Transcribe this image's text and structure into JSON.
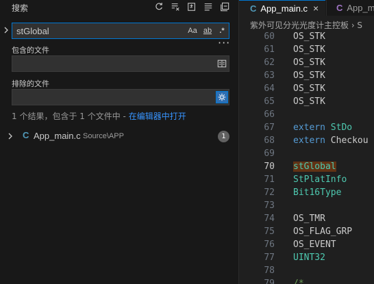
{
  "search_panel": {
    "title": "搜索",
    "toolbar": [
      {
        "name": "refresh-icon"
      },
      {
        "name": "clear-results-icon"
      },
      {
        "name": "new-search-editor-icon"
      },
      {
        "name": "view-as-tree-icon"
      },
      {
        "name": "collapse-all-icon"
      }
    ],
    "search": {
      "value": "stGlobal",
      "options": [
        "Aa",
        "ab",
        ".*"
      ]
    },
    "include": {
      "label": "包含的文件",
      "value": ""
    },
    "exclude": {
      "label": "排除的文件",
      "value": ""
    },
    "result_summary": "1 个结果，包含于 1 个文件中 - ",
    "open_in_editor": "在编辑器中打开",
    "file_result": {
      "icon": "C",
      "name": "App_main.c",
      "path": "Source\\APP",
      "count": "1"
    }
  },
  "editor": {
    "tabs": [
      {
        "icon": "C",
        "label": "App_main.c",
        "close": "×",
        "active": true
      },
      {
        "icon": "C",
        "label": "App_m"
      }
    ],
    "breadcrumb": "紫外可见分光光度计主控板 › S",
    "current_line": 70,
    "lines": [
      {
        "n": "60",
        "t": "OS_STK"
      },
      {
        "n": "61",
        "t": "OS_STK"
      },
      {
        "n": "62",
        "t": "OS_STK"
      },
      {
        "n": "63",
        "t": "OS_STK"
      },
      {
        "n": "64",
        "t": "OS_STK"
      },
      {
        "n": "65",
        "t": "OS_STK"
      },
      {
        "n": "66",
        "t": ""
      },
      {
        "n": "67",
        "kw": "extern",
        "t": "StDo"
      },
      {
        "n": "68",
        "kw": "extern",
        "t": "Checkou"
      },
      {
        "n": "69",
        "t": ""
      },
      {
        "n": "70",
        "t": "stGlobal",
        "highlight": true
      },
      {
        "n": "71",
        "t": "StPlatInfo"
      },
      {
        "n": "72",
        "t": "Bit16Type"
      },
      {
        "n": "73",
        "t": ""
      },
      {
        "n": "74",
        "t": "OS_TMR"
      },
      {
        "n": "75",
        "t": "OS_FLAG_GRP"
      },
      {
        "n": "76",
        "t": "OS_EVENT"
      },
      {
        "n": "77",
        "t": "UINT32"
      },
      {
        "n": "78",
        "t": ""
      },
      {
        "n": "79",
        "t": "/*"
      }
    ]
  },
  "colors": {
    "accent": "#0078d4",
    "link": "#3794ff",
    "type": "#4ec9b0",
    "keyword": "#569cd6",
    "comment": "#6a9955",
    "match_highlight": "#613214"
  }
}
